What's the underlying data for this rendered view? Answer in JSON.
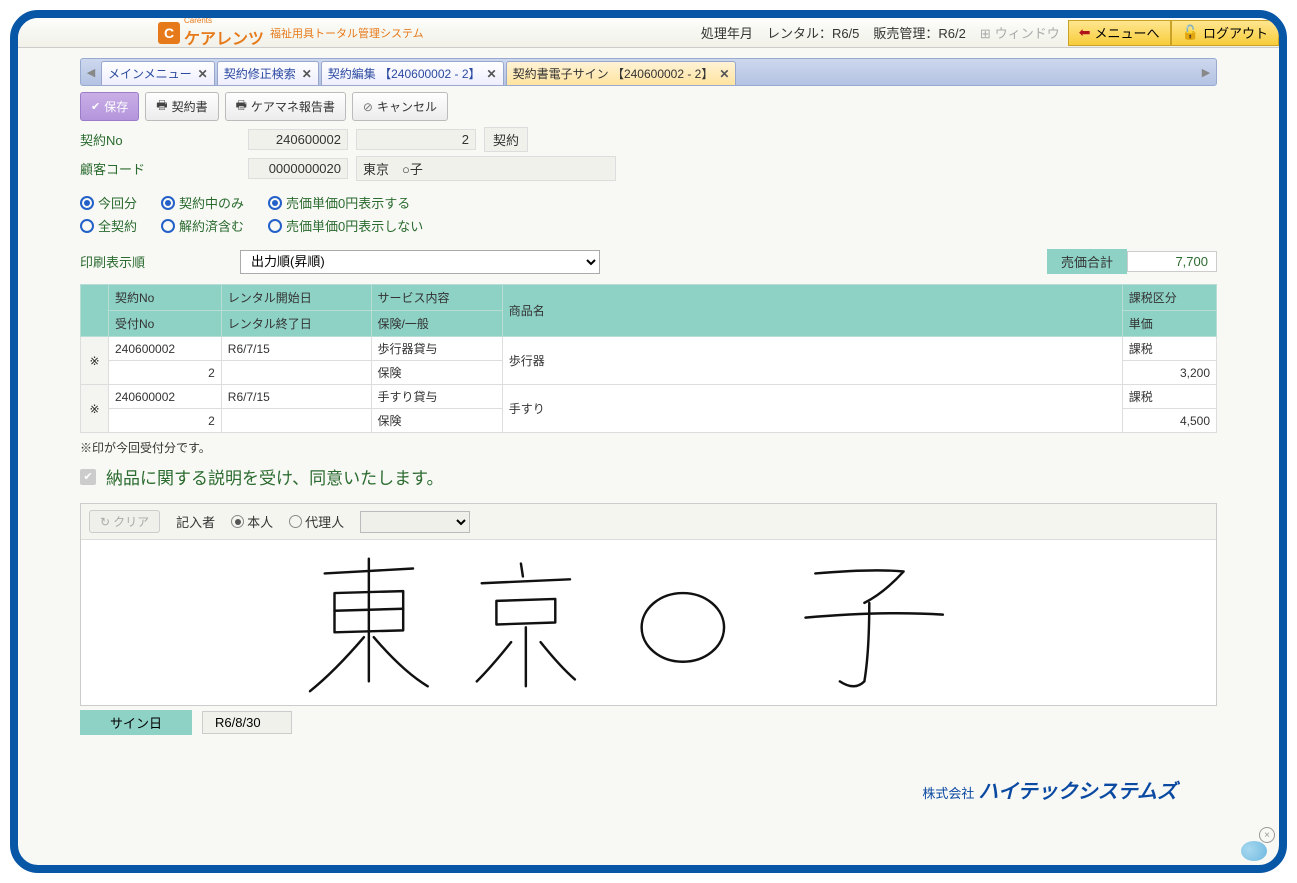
{
  "header": {
    "brand_initial": "C",
    "brand_small": "Carents",
    "brand_name": "ケアレンツ",
    "brand_sub": "福祉用具トータル管理システム",
    "period_label": "処理年月",
    "rental_label": "レンタル：R6/5",
    "sales_label": "販売管理：R6/2",
    "window_label": "ウィンドウ",
    "menu_btn": "メニューへ",
    "logout_btn": "ログアウト"
  },
  "tabs": {
    "t1": "メインメニュー",
    "t2": "契約修正検索",
    "t3": "契約編集 【240600002 - 2】",
    "t4": "契約書電子サイン 【240600002 - 2】"
  },
  "toolbar": {
    "save": "保存",
    "print_contract": "契約書",
    "print_report": "ケアマネ報告書",
    "cancel": "キャンセル"
  },
  "form": {
    "contract_no_label": "契約No",
    "contract_no": "240600002",
    "branch": "2",
    "contract_label": "契約",
    "customer_code_label": "顧客コード",
    "customer_code": "0000000020",
    "customer_name": "東京　○子"
  },
  "radios": {
    "r1a": "今回分",
    "r1b": "全契約",
    "r2a": "契約中のみ",
    "r2b": "解約済含む",
    "r3a": "売価単価0円表示する",
    "r3b": "売価単価0円表示しない"
  },
  "sort": {
    "label": "印刷表示順",
    "value": "出力順(昇順)"
  },
  "total": {
    "label": "売価合計",
    "value": "7,700"
  },
  "grid_headers": {
    "h1a": "契約No",
    "h1b": "受付No",
    "h2a": "レンタル開始日",
    "h2b": "レンタル終了日",
    "h3a": "サービス内容",
    "h3b": "保険/一般",
    "h4": "商品名",
    "h5a": "課税区分",
    "h5b": "単価"
  },
  "rows": [
    {
      "mark": "※",
      "cno": "240600002",
      "rno": "2",
      "start": "R6/7/15",
      "end": "",
      "svc": "歩行器貸与",
      "ins": "保険",
      "item": "歩行器",
      "tax": "課税",
      "price": "3,200"
    },
    {
      "mark": "※",
      "cno": "240600002",
      "rno": "2",
      "start": "R6/7/15",
      "end": "",
      "svc": "手すり貸与",
      "ins": "保険",
      "item": "手すり",
      "tax": "課税",
      "price": "4,500"
    }
  ],
  "note": "※印が今回受付分です。",
  "consent": {
    "text": "納品に関する説明を受け、同意いたします。"
  },
  "sign": {
    "clear": "クリア",
    "signer_label": "記入者",
    "self": "本人",
    "proxy": "代理人",
    "date_label": "サイン日",
    "date_value": "R6/8/30"
  },
  "footer": {
    "pre": "株式会社",
    "company": "ハイテックシステムズ"
  }
}
